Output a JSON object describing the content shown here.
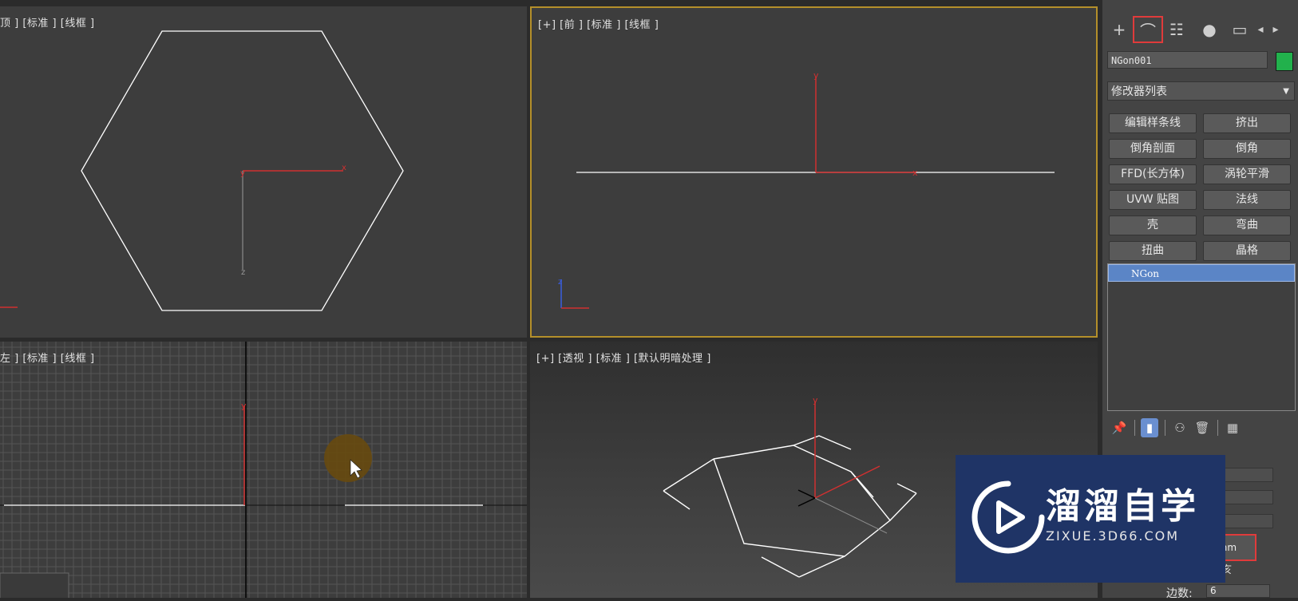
{
  "viewports": {
    "top": {
      "label": "顶 ] [标准 ] [线框 ]"
    },
    "front": {
      "label": "[+] [前 ] [标准 ] [线框 ]"
    },
    "left": {
      "label": "左 ] [标准 ] [线框 ]"
    },
    "perspective": {
      "label": "[+] [透视 ] [标准 ] [默认明暗处理 ]"
    },
    "axis_x": "x",
    "axis_y": "y",
    "axis_z": "z"
  },
  "command_panel": {
    "tabs": [
      {
        "icon": "create-plus-icon",
        "glyph": "+"
      },
      {
        "icon": "modify-icon",
        "glyph": "⌒",
        "active": true
      },
      {
        "icon": "hierarchy-icon",
        "glyph": "☷"
      },
      {
        "icon": "motion-icon",
        "glyph": "●"
      },
      {
        "icon": "display-icon",
        "glyph": "▭"
      },
      {
        "icon": "scroll-left-icon",
        "glyph": "◂"
      },
      {
        "icon": "scroll-right-icon",
        "glyph": "▸"
      }
    ],
    "object_name": "NGon001",
    "object_color": "#22b14c",
    "modifier_list": "修改器列表",
    "modifier_buttons": [
      "编辑样条线",
      "挤出",
      "倒角剖面",
      "倒角",
      "FFD(长方体)",
      "涡轮平滑",
      "UVW 贴图",
      "法线",
      "壳",
      "弯曲",
      "扭曲",
      "晶格"
    ],
    "stack_item": "NGon",
    "radius_value": "0mm",
    "radius_extra": "亥",
    "edges_label": "边数:",
    "edges_value": "6"
  },
  "watermark": {
    "title": "溜溜自学",
    "url": "ZIXUE.3D66.COM"
  },
  "colors": {
    "accent_red": "#e03b3b",
    "active_viewport_border": "#b48f2a",
    "selection_blue": "#5b85c6"
  }
}
